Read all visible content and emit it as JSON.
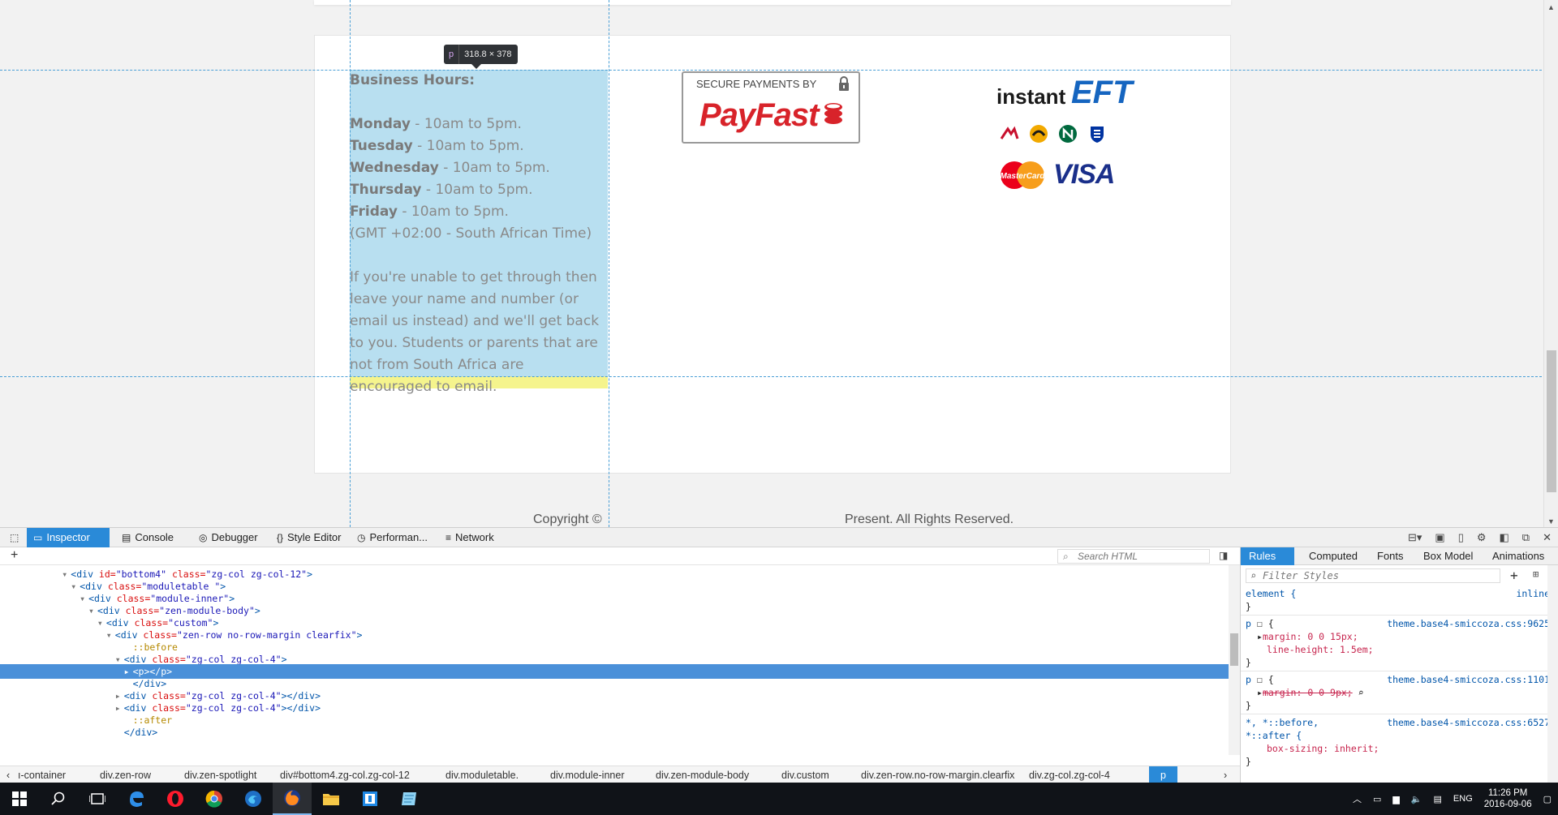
{
  "page": {
    "tooltip": {
      "tag": "p",
      "dims": "318.8 × 378"
    },
    "business_hours": {
      "heading": "Business Hours:",
      "days": [
        {
          "day": "Monday",
          "hours": " - 10am to 5pm."
        },
        {
          "day": "Tuesday",
          "hours": " - 10am to 5pm."
        },
        {
          "day": "Wednesday",
          "hours": " - 10am to 5pm."
        },
        {
          "day": "Thursday",
          "hours": " - 10am to 5pm."
        },
        {
          "day": "Friday",
          "hours": " - 10am to 5pm."
        }
      ],
      "timezone": "(GMT +02:00 - South African Time)",
      "note": "If you're unable to get through then leave your name and number (or email us instead) and we'll get back to you. Students or parents that are not from South Africa are encouraged to email."
    },
    "payfast": {
      "secure_label": "SECURE PAYMENTS BY",
      "logo": "PayFast"
    },
    "eft": {
      "instant": "instant",
      "eft": "EFT"
    },
    "mastercard_label": "MasterCard",
    "visa_label": "VISA",
    "copyright_left": "Copyright ©",
    "copyright_right": "Present. All Rights Reserved."
  },
  "devtools": {
    "tabs": [
      {
        "label": "Inspector",
        "icon": "inspector-icon"
      },
      {
        "label": "Console",
        "icon": "console-icon"
      },
      {
        "label": "Debugger",
        "icon": "debugger-icon"
      },
      {
        "label": "Style Editor",
        "icon": "style-editor-icon"
      },
      {
        "label": "Performan...",
        "icon": "performance-icon"
      },
      {
        "label": "Network",
        "icon": "network-icon"
      }
    ],
    "search_placeholder": "Search HTML",
    "markup": [
      {
        "indent": 7,
        "tw": "▾",
        "text": [
          "<div ",
          "id=",
          "\"bottom4\"",
          " class=",
          "\"zg-col zg-col-12\"",
          ">"
        ]
      },
      {
        "indent": 8,
        "tw": "▾",
        "text": [
          "<div ",
          "class=",
          "\"moduletable \"",
          "",
          "",
          ">"
        ]
      },
      {
        "indent": 9,
        "tw": "▾",
        "text": [
          "<div ",
          "class=",
          "\"module-inner\"",
          "",
          "",
          ">"
        ]
      },
      {
        "indent": 10,
        "tw": "▾",
        "text": [
          "<div ",
          "class=",
          "\"zen-module-body\"",
          "",
          "",
          ">"
        ]
      },
      {
        "indent": 11,
        "tw": "▾",
        "text": [
          "<div ",
          "class=",
          "\"custom\"",
          "",
          "",
          ">"
        ]
      },
      {
        "indent": 12,
        "tw": "▾",
        "text": [
          "<div ",
          "class=",
          "\"zen-row no-row-margin clearfix\"",
          "",
          "",
          ">"
        ]
      },
      {
        "indent": 14,
        "tw": "",
        "pseudo": "::before"
      },
      {
        "indent": 13,
        "tw": "▾",
        "text": [
          "<div ",
          "class=",
          "\"zg-col zg-col-4\"",
          "",
          "",
          ">"
        ]
      },
      {
        "indent": 14,
        "tw": "▸",
        "text": [
          "<p></p>",
          "",
          "",
          "",
          "",
          ""
        ],
        "selected": true
      },
      {
        "indent": 14,
        "tw": "",
        "text": [
          "</div>",
          "",
          "",
          "",
          "",
          ""
        ]
      },
      {
        "indent": 13,
        "tw": "▸",
        "text": [
          "<div ",
          "class=",
          "\"zg-col zg-col-4\"",
          "",
          "",
          "></div>"
        ]
      },
      {
        "indent": 13,
        "tw": "▸",
        "text": [
          "<div ",
          "class=",
          "\"zg-col zg-col-4\"",
          "",
          "",
          "></div>"
        ]
      },
      {
        "indent": 14,
        "tw": "",
        "pseudo": "::after"
      },
      {
        "indent": 13,
        "tw": "",
        "text": [
          "</div>",
          "",
          "",
          "",
          "",
          ""
        ]
      }
    ],
    "breadcrumbs": [
      "ı-container",
      "div.zen-row",
      "div.zen-spotlight",
      "div#bottom4.zg-col.zg-col-12",
      "div.moduletable.",
      "div.module-inner",
      "div.zen-module-body",
      "div.custom",
      "div.zen-row.no-row-margin.clearfix",
      "div.zg-col.zg-col-4",
      "p"
    ],
    "sidebar_tabs": [
      "Rules",
      "Computed",
      "Fonts",
      "Box Model",
      "Animations"
    ],
    "filter_placeholder": "Filter Styles",
    "rules": {
      "element_sel": "element {",
      "element_src": "inline",
      "close": "}",
      "r1_sel": "p",
      "r1_src": "theme.base4-smiccoza.css:9625",
      "r1_p1": "margin: 0 0 15px;",
      "r1_p2": "line-height: 1.5em;",
      "r2_sel": "p",
      "r2_src": "theme.base4-smiccoza.css:1101",
      "r2_p1": "margin: 0 0 9px;",
      "r3_sel": "*, *::before,",
      "r3_sel2": "*::after {",
      "r3_src": "theme.base4-smiccoza.css:6527",
      "r3_p1": "box-sizing: inherit;"
    }
  },
  "taskbar": {
    "clock_time": "11:26 PM",
    "clock_date": "2016-09-06",
    "lang": "ENG"
  },
  "colors": {
    "accent": "#2a8ad8",
    "highlight": "#b8dff0",
    "margin": "#f5f48d"
  }
}
